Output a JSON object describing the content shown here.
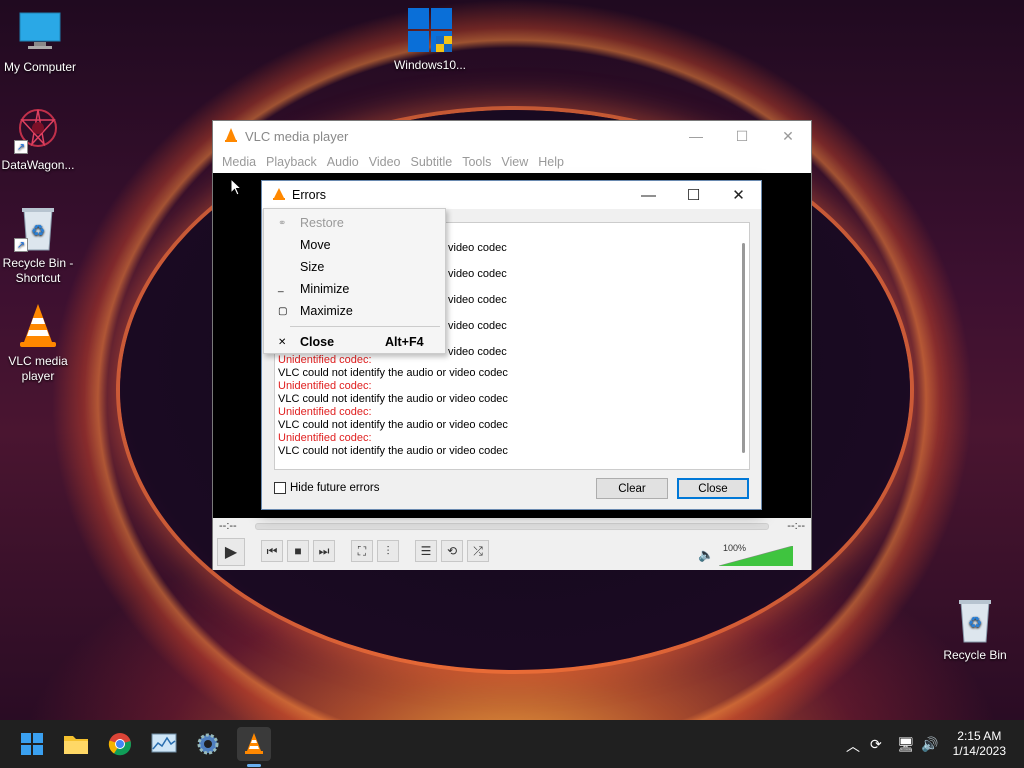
{
  "desktop": {
    "icons": [
      {
        "label": "My Computer",
        "icon": "monitor-icon"
      },
      {
        "label": "Windows10...",
        "icon": "windows-logo-icon"
      },
      {
        "label": "DataWagon...",
        "icon": "datawagon-icon"
      },
      {
        "label_line1": "Recycle Bin -",
        "label_line2": "Shortcut",
        "icon": "recycle-bin-icon"
      },
      {
        "label_line1": "VLC media",
        "label_line2": "player",
        "icon": "vlc-cone-icon"
      },
      {
        "label": "Recycle Bin",
        "icon": "recycle-bin-icon"
      }
    ]
  },
  "vlc": {
    "title": "VLC media player",
    "menu": [
      "Media",
      "Playback",
      "Audio",
      "Video",
      "Subtitle",
      "Tools",
      "View",
      "Help"
    ],
    "time_left": "--:--",
    "time_right": "--:--",
    "volume": "100%",
    "volume_level": 1.0
  },
  "errors_dialog": {
    "title": "Errors",
    "partial_lines": [
      "video codec",
      "video codec",
      "video codec",
      "video codec",
      "video codec"
    ],
    "log": [
      {
        "kind": "title",
        "text": "Unidentified codec:"
      },
      {
        "kind": "msg",
        "text": "VLC could not identify the audio or video codec"
      },
      {
        "kind": "title",
        "text": "Unidentified codec:"
      },
      {
        "kind": "msg",
        "text": "VLC could not identify the audio or video codec"
      },
      {
        "kind": "title",
        "text": "Unidentified codec:"
      },
      {
        "kind": "msg",
        "text": "VLC could not identify the audio or video codec"
      },
      {
        "kind": "title",
        "text": "Unidentified codec:"
      },
      {
        "kind": "msg",
        "text": "VLC could not identify the audio or video codec"
      }
    ],
    "hide_label": "Hide future errors",
    "clear_label": "Clear",
    "close_label": "Close"
  },
  "context_menu": {
    "restore": "Restore",
    "move": "Move",
    "size": "Size",
    "minimize": "Minimize",
    "maximize": "Maximize",
    "close": "Close",
    "close_shortcut": "Alt+F4"
  },
  "taskbar": {
    "time": "2:15 AM",
    "date": "1/14/2023"
  }
}
